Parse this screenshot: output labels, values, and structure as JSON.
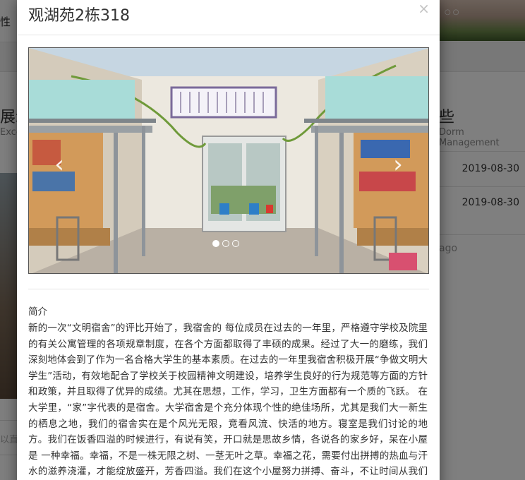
{
  "background": {
    "nav_fragment": "性",
    "title_left_fragment": "展示",
    "sub_left_fragment": "Excel",
    "title_right_fragment": "些",
    "sub_right_fragment": "Dorm Management",
    "dates": [
      "2019-08-30",
      "2019-08-30"
    ],
    "ago_fragment": "ago",
    "input_fragment": "以直",
    "carousel_dots": "○○"
  },
  "modal": {
    "title": "观湖苑2栋318",
    "close_label": "×",
    "carousel": {
      "prev_label": "‹",
      "next_label": "›",
      "indicator_count": 3,
      "active_index": 0,
      "photo_description_hidden": ""
    },
    "intro_heading": "简介",
    "intro_text": "新的一次“文明宿舍”的评比开始了，我宿舍的 每位成员在过去的一年里，严格遵守学校及院里的有关公寓管理的各项规章制度，在各个方面都取得了丰硕的成果。经过了大一的磨练，我们深刻地体会到了作为一名合格大学生的基本素质。在过去的一年里我宿舍积极开展“争做文明大学生”活动，有效地配合了学校关于校园精神文明建设，培养学生良好的行为规范等方面的方针和政策，并且取得了优异的成绩。尤其在思想，工作，学习，卫生方面都有一个质的飞跃。 在大学里，“家”字代表的是宿舍。大学宿舍是个充分体现个性的绝佳场所，尤其是我们大一新生的栖息之地，我们的宿舍实在是个风光无限，竞看风流、快活的地方。寝室是我们讨论的地方。我们在饭香四溢的时候进行，有说有笑，开口就是思故乡情，各说各的家乡好，呆在小屋是 一种幸福。幸福，不是一株无限之树、一茎无叶之草。幸福之花，需要付出拼搏的热血与汗水的滋养浇灌，才能绽放盛开，芳香四溢。我们在这个小屋努力拼搏、奋斗，不让时间从我们身边溜走。生活在一个好的环境中是一件幸福又很快乐的事，庆幸的是"
  }
}
